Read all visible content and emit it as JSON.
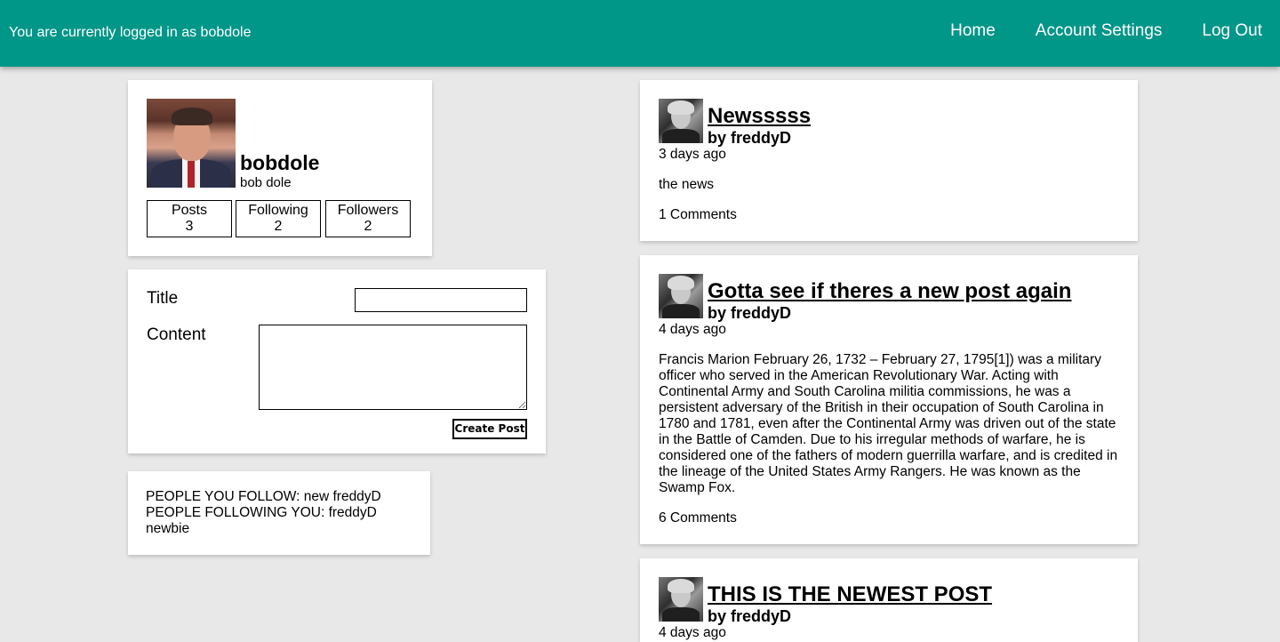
{
  "header": {
    "login_status": "You are currently logged in as bobdole",
    "nav": [
      "Home",
      "Account Settings",
      "Log Out"
    ],
    "bg_color": "#009688"
  },
  "profile": {
    "username": "bobdole",
    "full_name": "bob dole",
    "stats": [
      {
        "label": "Posts",
        "value": "3"
      },
      {
        "label": "Following",
        "value": "2"
      },
      {
        "label": "Followers",
        "value": "2"
      }
    ]
  },
  "post_form": {
    "title_label": "Title",
    "content_label": "Content",
    "title_value": "",
    "content_value": "",
    "submit_label": "Create Post"
  },
  "follow_info": {
    "following_line": "PEOPLE YOU FOLLOW: new freddyD",
    "followers_line": "PEOPLE FOLLOWING YOU: freddyD newbie"
  },
  "posts": [
    {
      "title": "Newsssss",
      "author": "by freddyD",
      "time": "3 days ago",
      "body": "the news",
      "comments": "1 Comments"
    },
    {
      "title": "Gotta see if theres a new post again",
      "author": "by freddyD",
      "time": "4 days ago",
      "body": "Francis Marion February 26, 1732 – February 27, 1795[1]) was a military officer who served in the American Revolutionary War. Acting with Continental Army and South Carolina militia commissions, he was a persistent adversary of the British in their occupation of South Carolina in 1780 and 1781, even after the Continental Army was driven out of the state in the Battle of Camden. Due to his irregular methods of warfare, he is considered one of the fathers of modern guerrilla warfare, and is credited in the lineage of the United States Army Rangers. He was known as the Swamp Fox.",
      "comments": "6 Comments"
    },
    {
      "title": "THIS IS THE NEWEST POST",
      "author": "by freddyD",
      "time": "4 days ago"
    }
  ]
}
